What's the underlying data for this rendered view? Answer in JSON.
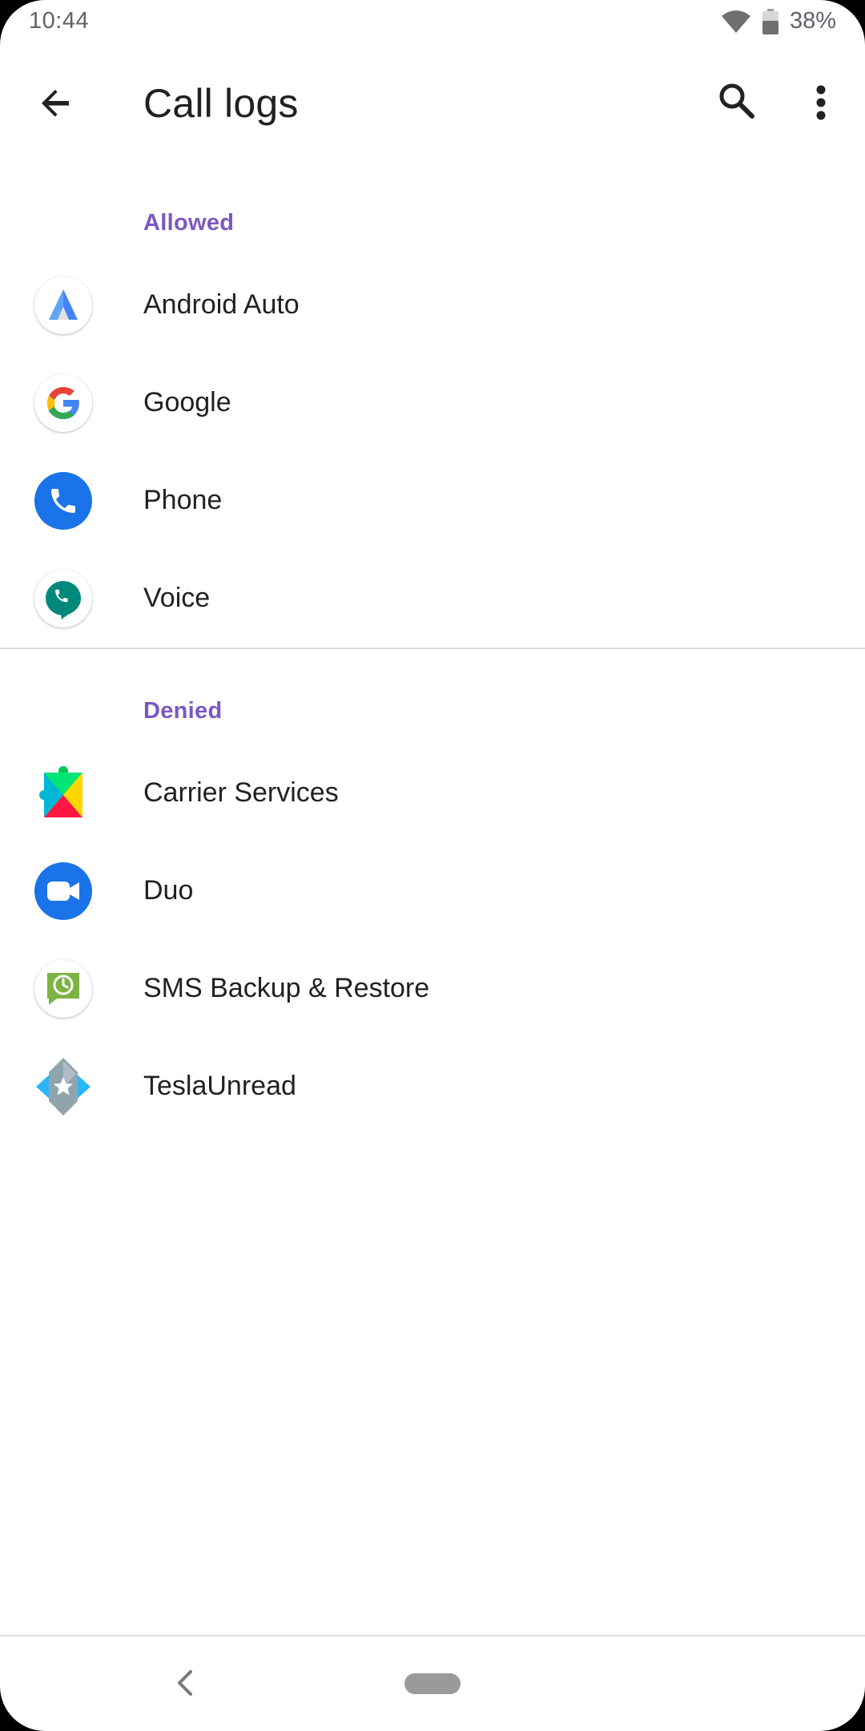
{
  "status_bar": {
    "time": "10:44",
    "battery": "38%"
  },
  "app_bar": {
    "title": "Call logs",
    "back_icon": "arrow-back-icon",
    "search_icon": "search-icon",
    "more_icon": "more-vert-icon"
  },
  "sections": {
    "allowed": {
      "title": "Allowed",
      "items": [
        {
          "label": "Android Auto",
          "icon": "android-auto-icon"
        },
        {
          "label": "Google",
          "icon": "google-icon"
        },
        {
          "label": "Phone",
          "icon": "phone-icon"
        },
        {
          "label": "Voice",
          "icon": "voice-icon"
        }
      ]
    },
    "denied": {
      "title": "Denied",
      "items": [
        {
          "label": "Carrier Services",
          "icon": "carrier-services-icon"
        },
        {
          "label": "Duo",
          "icon": "duo-icon"
        },
        {
          "label": "SMS Backup & Restore",
          "icon": "sms-backup-icon"
        },
        {
          "label": "TeslaUnread",
          "icon": "teslaunread-icon"
        }
      ]
    }
  },
  "colors": {
    "section_header": "#7b57c4",
    "text_primary": "#202124",
    "phone_blue": "#1a73e8",
    "voice_teal": "#00897b"
  }
}
